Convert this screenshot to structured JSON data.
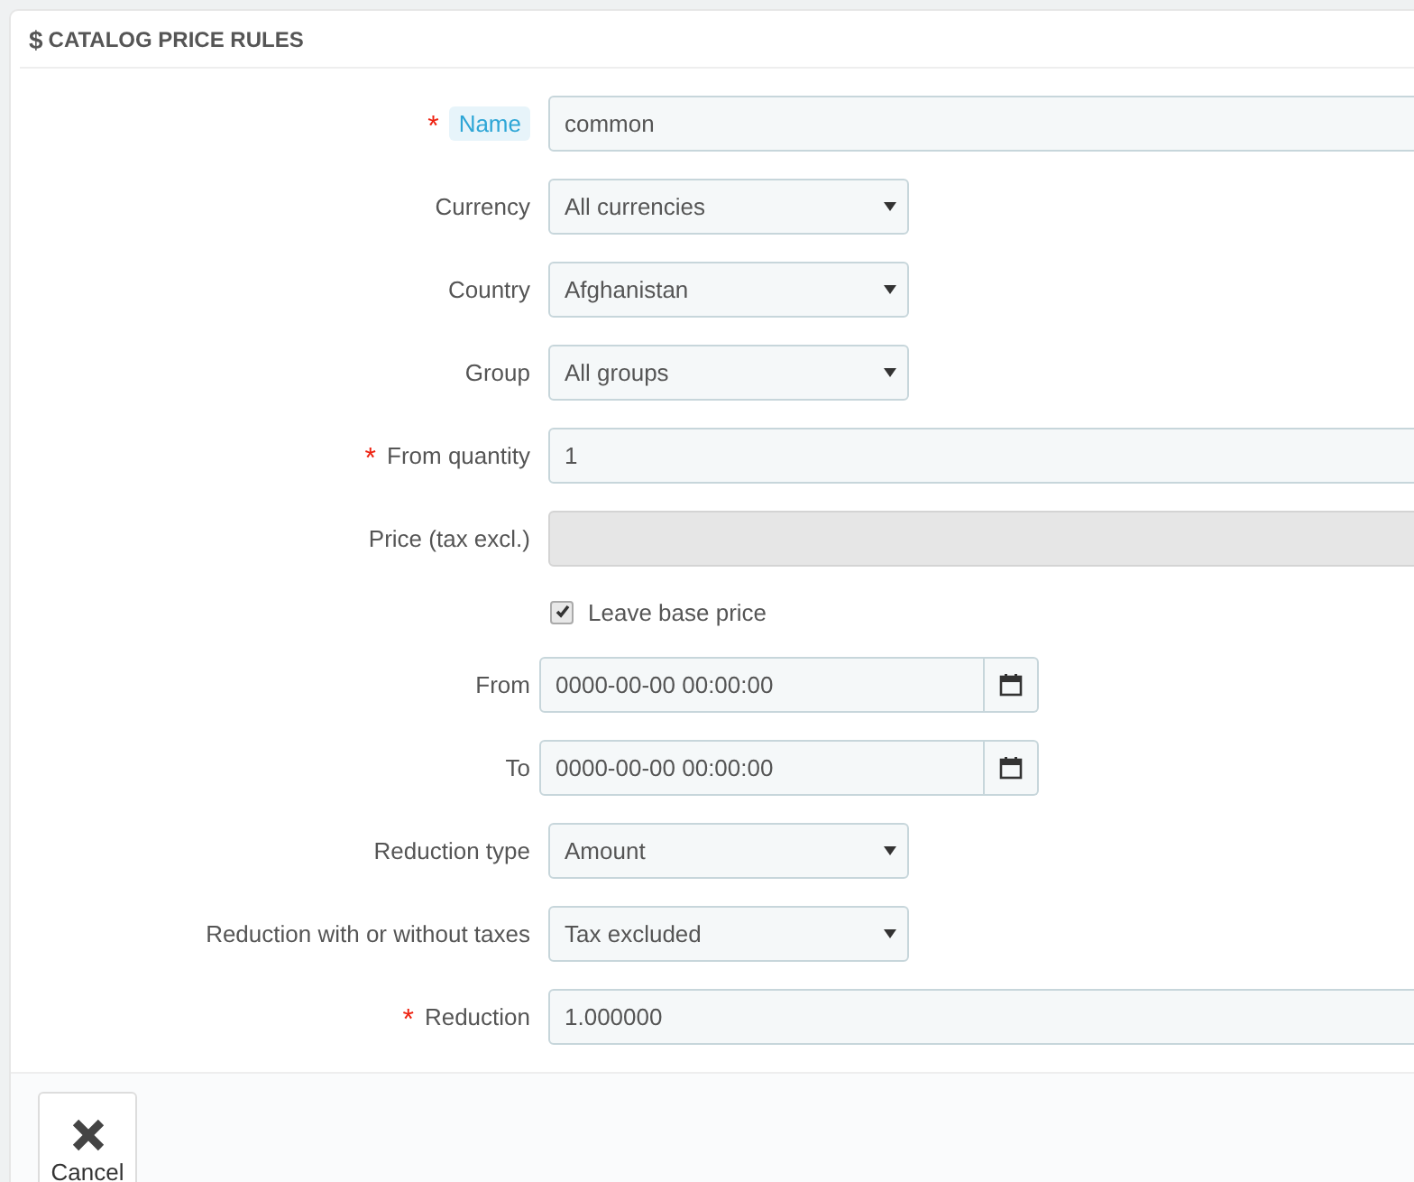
{
  "panel": {
    "icon": "$",
    "title": "CATALOG PRICE RULES"
  },
  "fields": [
    {
      "kind": "text",
      "label": "Name",
      "required_mark": "*",
      "help": true,
      "value": "common",
      "disabled": false
    },
    {
      "kind": "select",
      "label": "Currency",
      "help": false,
      "value": "All currencies"
    },
    {
      "kind": "select",
      "label": "Country",
      "help": false,
      "value": "Afghanistan"
    },
    {
      "kind": "select",
      "label": "Group",
      "help": false,
      "value": "All groups"
    },
    {
      "kind": "text",
      "label": "From quantity",
      "required_mark": "*",
      "help": false,
      "value": "1",
      "disabled": false
    },
    {
      "kind": "text",
      "label": "Price (tax excl.)",
      "help": false,
      "disabled": true
    },
    {
      "kind": "checkbox",
      "label": "Leave base price",
      "checked": true
    },
    {
      "kind": "date",
      "label": "From",
      "help": false,
      "value": "0000-00-00 00:00:00"
    },
    {
      "kind": "date",
      "label": "To",
      "help": false,
      "value": "0000-00-00 00:00:00"
    },
    {
      "kind": "select",
      "label": "Reduction type",
      "help": false,
      "value": "Amount"
    },
    {
      "kind": "select",
      "label": "Reduction with or without taxes",
      "help": false,
      "value": "Tax excluded"
    },
    {
      "kind": "text",
      "label": "Reduction",
      "required_mark": "*",
      "help": false,
      "value": "1.000000",
      "disabled": false
    }
  ],
  "footer": {
    "cancel_button": "Cancel"
  }
}
